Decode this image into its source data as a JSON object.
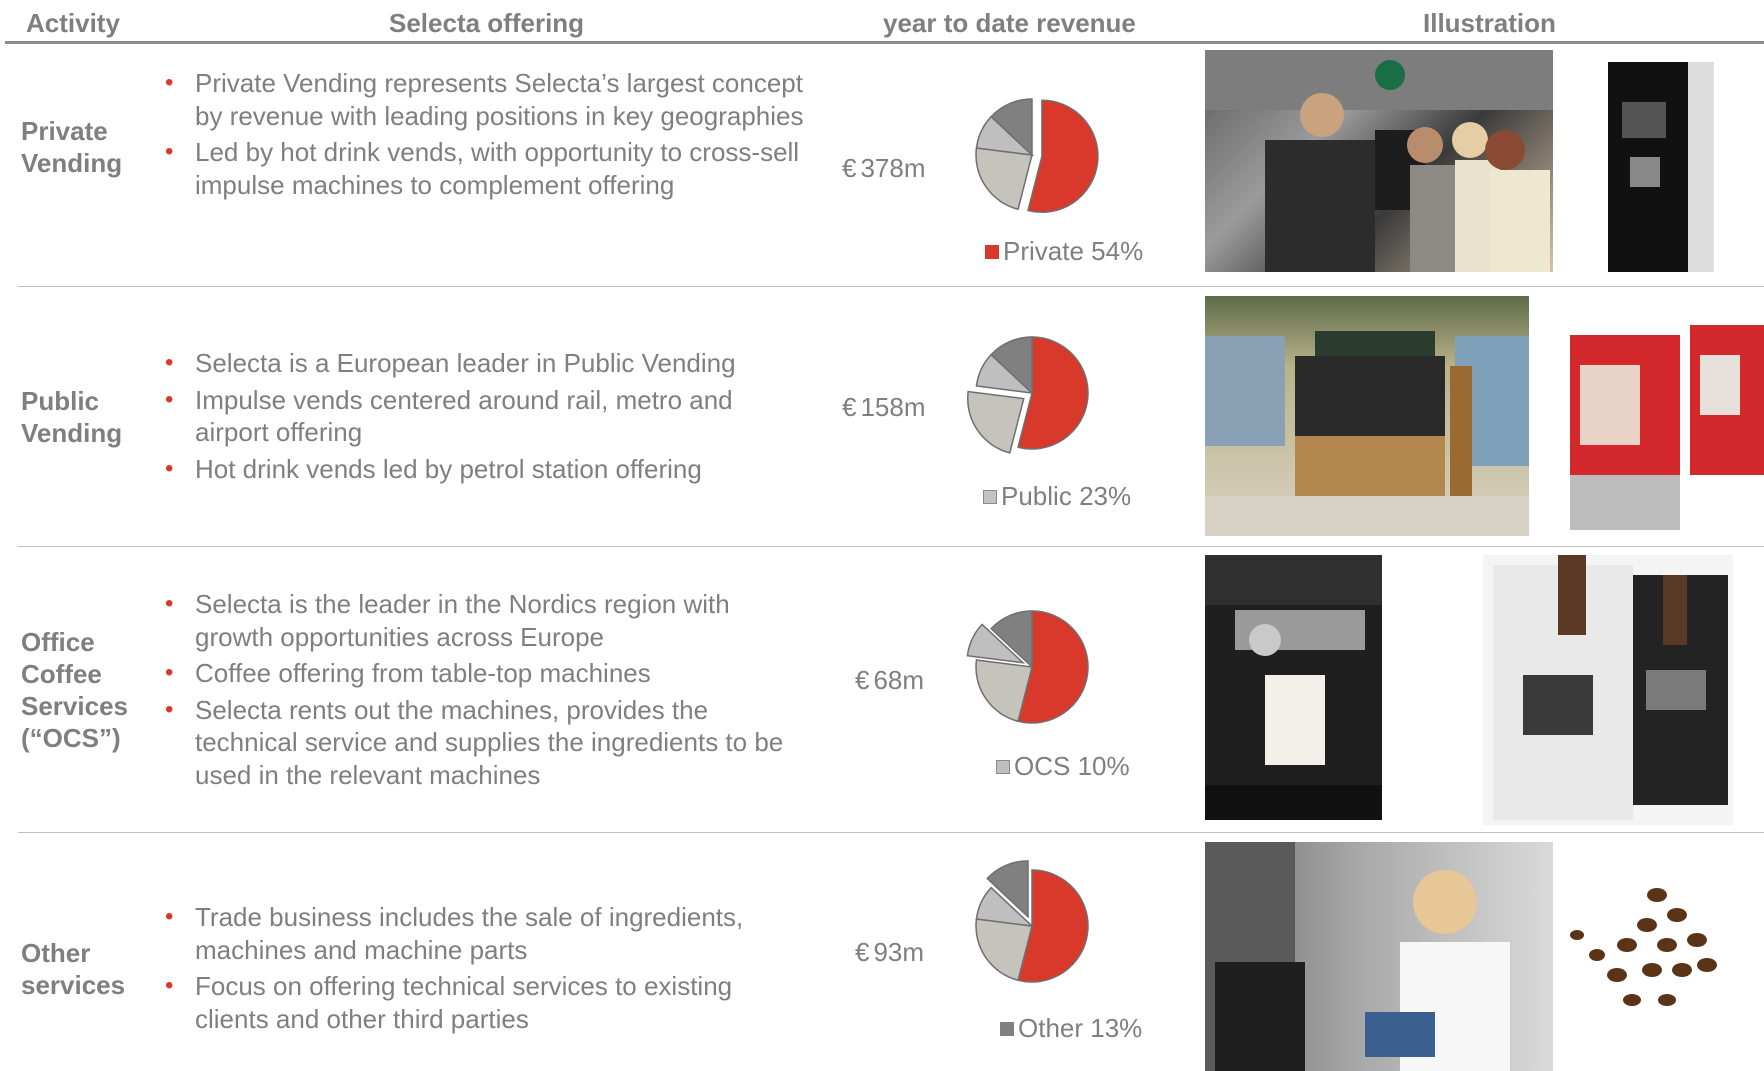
{
  "header": {
    "activity": "Activity",
    "offering": "Selecta offering",
    "revenue_line1": "year to date revenue",
    "illustration": "Illustration"
  },
  "colors": {
    "accent_red": "#d9392b",
    "light_grey": "#c6c3bc",
    "mid_grey": "#bfbfbf",
    "dark_grey": "#808080",
    "text_grey": "#7f7f7f"
  },
  "rows": [
    {
      "activity": [
        "Private",
        "Vending"
      ],
      "bullets": [
        "Private Vending represents Selecta’s largest concept by revenue with leading positions in key geographies",
        "Led by hot drink vends, with opportunity to cross-sell impulse machines to complement offering"
      ],
      "revenue": "378m",
      "currency": "€",
      "legend_label": "Private",
      "legend_value": "54%",
      "legend_swatch": "#d9392b"
    },
    {
      "activity": [
        "Public",
        "Vending"
      ],
      "bullets": [
        "Selecta is a European leader in Public Vending",
        "Impulse vends centered around rail, metro and airport offering",
        "Hot drink vends led by petrol station offering"
      ],
      "revenue": "158m",
      "currency": "€",
      "legend_label": "Public",
      "legend_value": "23%",
      "legend_swatch": "#c6c3bc"
    },
    {
      "activity": [
        "Office",
        "Coffee",
        "Services",
        "(“OCS”)"
      ],
      "bullets": [
        "Selecta is the leader in the Nordics region with growth opportunities across Europe",
        "Coffee offering from table-top machines",
        "Selecta rents out the machines, provides the technical service and supplies the ingredients to be used in the relevant machines"
      ],
      "revenue": "68m",
      "currency": "€",
      "legend_label": "OCS",
      "legend_value": "10%",
      "legend_swatch": "#bfbfbf"
    },
    {
      "activity": [
        "Other",
        "services"
      ],
      "bullets": [
        "Trade business includes the sale of ingredients, machines and machine parts",
        "Focus on offering technical services to existing clients and other third parties"
      ],
      "revenue": "93m",
      "currency": "€",
      "legend_label": "Other",
      "legend_value": "13%",
      "legend_swatch": "#808080"
    }
  ],
  "chart_data": [
    {
      "type": "pie",
      "labels": [
        "Private",
        "Public",
        "OCS",
        "Other"
      ],
      "values": [
        54,
        23,
        10,
        13
      ],
      "exploded": "Private"
    },
    {
      "type": "pie",
      "labels": [
        "Private",
        "Public",
        "OCS",
        "Other"
      ],
      "values": [
        54,
        23,
        10,
        13
      ],
      "exploded": "Public"
    },
    {
      "type": "pie",
      "labels": [
        "Private",
        "Public",
        "OCS",
        "Other"
      ],
      "values": [
        54,
        23,
        10,
        13
      ],
      "exploded": "OCS"
    },
    {
      "type": "pie",
      "labels": [
        "Private",
        "Public",
        "OCS",
        "Other"
      ],
      "values": [
        54,
        23,
        10,
        13
      ],
      "exploded": "Other"
    }
  ]
}
